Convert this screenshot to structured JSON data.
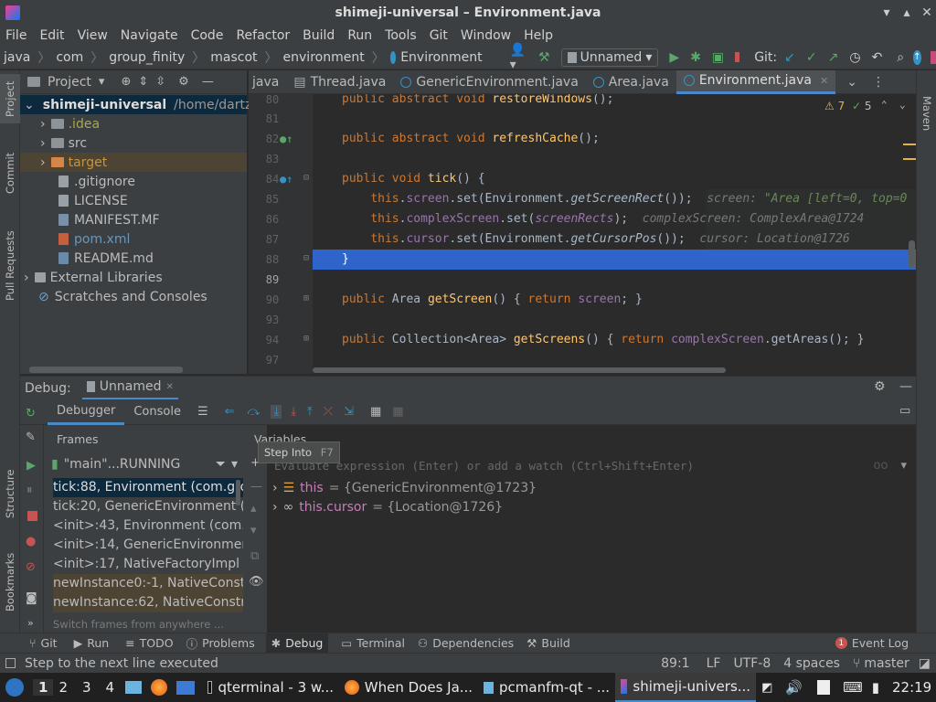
{
  "window": {
    "title": "shimeji-universal – Environment.java"
  },
  "menu": [
    "File",
    "Edit",
    "View",
    "Navigate",
    "Code",
    "Refactor",
    "Build",
    "Run",
    "Tools",
    "Git",
    "Window",
    "Help"
  ],
  "breadcrumbs": [
    "java",
    "com",
    "group_finity",
    "mascot",
    "environment",
    "Environment"
  ],
  "run_config": "Unnamed",
  "git_label": "Git:",
  "project_panel": {
    "title": "Project",
    "tree": [
      {
        "label": "shimeji-universal",
        "extra": "/home/dartz",
        "kind": "root"
      },
      {
        "label": ".idea",
        "kind": "folder"
      },
      {
        "label": "src",
        "kind": "folder"
      },
      {
        "label": "target",
        "kind": "folder"
      },
      {
        "label": ".gitignore",
        "kind": "file"
      },
      {
        "label": "LICENSE",
        "kind": "file"
      },
      {
        "label": "MANIFEST.MF",
        "kind": "file"
      },
      {
        "label": "pom.xml",
        "kind": "file"
      },
      {
        "label": "README.md",
        "kind": "file"
      },
      {
        "label": "External Libraries",
        "kind": "lib"
      },
      {
        "label": "Scratches and Consoles",
        "kind": "scratch"
      }
    ]
  },
  "side_tabs_left": [
    "Project",
    "Commit",
    "Pull Requests",
    "Structure",
    "Bookmarks"
  ],
  "side_tabs_right": [
    "Maven"
  ],
  "editor_tabs": [
    {
      "label": "java",
      "active": false
    },
    {
      "label": "Thread.java",
      "active": false
    },
    {
      "label": "GenericEnvironment.java",
      "active": false
    },
    {
      "label": "Area.java",
      "active": false
    },
    {
      "label": "Environment.java",
      "active": true
    }
  ],
  "inspections": {
    "warnings": "7",
    "ok": "5"
  },
  "code_lines": [
    {
      "num": "80",
      "text": "public abstract void restoreWindows();"
    },
    {
      "num": "81",
      "text": ""
    },
    {
      "num": "82",
      "text": "public abstract void refreshCache();"
    },
    {
      "num": "83",
      "text": ""
    },
    {
      "num": "84",
      "text": "public void tick() {"
    },
    {
      "num": "85",
      "text": "    this.screen.set(Environment.getScreenRect());",
      "hint": "screen: \"Area [left=0, top=0"
    },
    {
      "num": "86",
      "text": "    this.complexScreen.set(screenRects);",
      "hint": "complexScreen: ComplexArea@1724"
    },
    {
      "num": "87",
      "text": "    this.cursor.set(Environment.getCursorPos());",
      "hint": "cursor: Location@1726"
    },
    {
      "num": "88",
      "text": "}"
    },
    {
      "num": "89",
      "text": ""
    },
    {
      "num": "90",
      "text": "public Area getScreen() { return screen; }"
    },
    {
      "num": "93",
      "text": ""
    },
    {
      "num": "94",
      "text": "public Collection<Area> getScreens() { return complexScreen.getAreas(); }"
    },
    {
      "num": "97",
      "text": ""
    }
  ],
  "debug": {
    "label": "Debug:",
    "session": "Unnamed",
    "tabs": [
      "Debugger",
      "Console"
    ],
    "frames_title": "Frames",
    "thread": "\"main\"...RUNNING",
    "frames": [
      "tick:88, Environment (com.gro",
      "tick:20, GenericEnvironment (c",
      "<init>:43, Environment (com.g",
      "<init>:14, GenericEnvironmen",
      "<init>:17, NativeFactoryImpl (",
      "newInstance0:-1, NativeConstr",
      "newInstance:62, NativeConstru"
    ],
    "switch_frames_hint": "Switch frames from anywhere ...",
    "variables_title": "Variables",
    "eval_placeholder": "Evaluate expression (Enter) or add a watch (Ctrl+Shift+Enter)",
    "variables": [
      {
        "name": "this",
        "value": "= {GenericEnvironment@1723}"
      },
      {
        "name": "this.cursor",
        "value": "= {Location@1726}"
      }
    ],
    "tooltip": {
      "label": "Step Into",
      "shortcut": "F7"
    }
  },
  "bottom_tabs": [
    "Git",
    "Run",
    "TODO",
    "Problems",
    "Debug",
    "Terminal",
    "Dependencies",
    "Build"
  ],
  "event_log": {
    "count": "1",
    "label": "Event Log"
  },
  "status": {
    "message": "Step to the next line executed",
    "position": "89:1",
    "line_sep": "LF",
    "encoding": "UTF-8",
    "indent": "4 spaces",
    "branch": "master"
  },
  "taskbar": {
    "workspaces": [
      "1",
      "2",
      "3",
      "4"
    ],
    "tasks": [
      "qterminal - 3 w...",
      "When Does Ja...",
      "pcmanfm-qt - ...",
      "shimeji-univers..."
    ],
    "clock": "22:19"
  },
  "colors": {
    "accent": "#4a88c7",
    "selection": "#2f65ca",
    "keyword": "#cc7832",
    "function": "#ffc66d",
    "field": "#9876aa"
  }
}
